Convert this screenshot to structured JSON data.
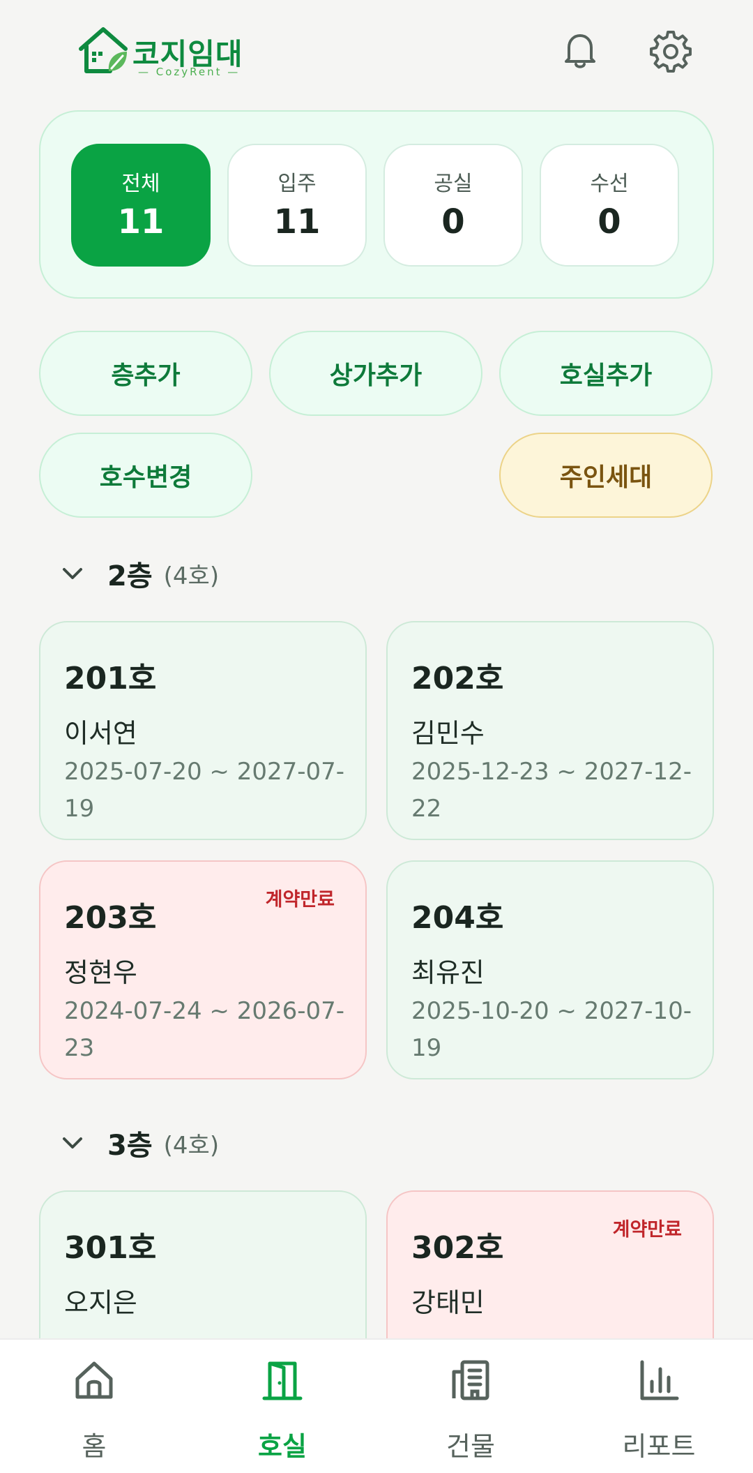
{
  "app": {
    "name": "코지임대",
    "subtitle": "— CozyRent —"
  },
  "stats": [
    {
      "label": "전체",
      "value": "11",
      "active": true
    },
    {
      "label": "입주",
      "value": "11",
      "active": false
    },
    {
      "label": "공실",
      "value": "0",
      "active": false
    },
    {
      "label": "수선",
      "value": "0",
      "active": false
    }
  ],
  "actions": {
    "add_floor": "층추가",
    "add_shop": "상가추가",
    "add_room": "호실추가",
    "change_number": "호수변경",
    "owner_household": "주인세대"
  },
  "floors": [
    {
      "title": "2층",
      "count": "(4호)",
      "rooms": [
        {
          "room": "201호",
          "tenant": "이서연",
          "period": "2025-07-20 ~ 2027-07-19",
          "badge": ""
        },
        {
          "room": "202호",
          "tenant": "김민수",
          "period": "2025-12-23 ~ 2027-12-22",
          "badge": ""
        },
        {
          "room": "203호",
          "tenant": "정현우",
          "period": "2024-07-24 ~ 2026-07-23",
          "badge": "계약만료"
        },
        {
          "room": "204호",
          "tenant": "최유진",
          "period": "2025-10-20 ~ 2027-10-19",
          "badge": ""
        }
      ]
    },
    {
      "title": "3층",
      "count": "(4호)",
      "rooms": [
        {
          "room": "301호",
          "tenant": "오지은",
          "period": "",
          "badge": ""
        },
        {
          "room": "302호",
          "tenant": "강태민",
          "period": "",
          "badge": "계약만료"
        }
      ]
    }
  ],
  "nav": [
    {
      "label": "홈",
      "icon": "home-icon",
      "active": false
    },
    {
      "label": "호실",
      "icon": "door-icon",
      "active": true
    },
    {
      "label": "건물",
      "icon": "building-icon",
      "active": false
    },
    {
      "label": "리포트",
      "icon": "bar-chart-icon",
      "active": false
    }
  ],
  "colors": {
    "primary": "#0aa344",
    "mint_bg": "#ecfcf3",
    "expired_bg": "#ffecec",
    "expired_text": "#c0262b",
    "owner_bg": "#fdf5d9"
  }
}
